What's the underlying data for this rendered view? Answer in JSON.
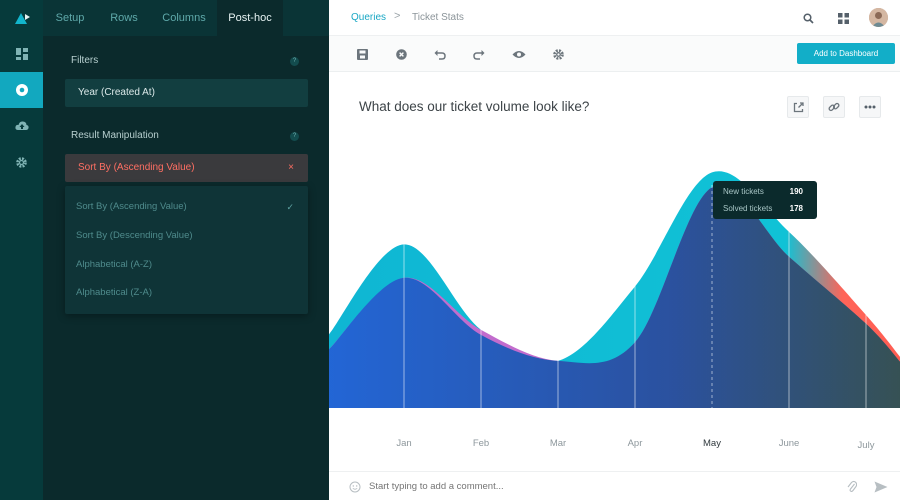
{
  "app": {
    "logo_icon": "brand-logo-icon"
  },
  "rail": {
    "items": [
      {
        "icon": "dashboard-grid-icon",
        "active": false
      },
      {
        "icon": "query-hub-icon",
        "active": true
      },
      {
        "icon": "cloud-upload-icon",
        "active": false
      },
      {
        "icon": "gear-icon",
        "active": false
      }
    ]
  },
  "panel": {
    "tabs": [
      {
        "label": "Setup",
        "active": false
      },
      {
        "label": "Rows",
        "active": false
      },
      {
        "label": "Columns",
        "active": false
      },
      {
        "label": "Post-hoc",
        "active": true
      }
    ],
    "filters_label": "Filters",
    "filter_item": "Year (Created At)",
    "result_label": "Result Manipulation",
    "sort_selected": "Sort By (Ascending Value)",
    "remove_symbol": "×",
    "help_symbol": "?",
    "sort_options": [
      {
        "label": "Sort By (Ascending Value)",
        "checked": true
      },
      {
        "label": "Sort By (Descending Value)",
        "checked": false
      },
      {
        "label": "Alphabetical (A-Z)",
        "checked": false
      },
      {
        "label": "Alphabetical (Z-A)",
        "checked": false
      }
    ],
    "check_symbol": "✓"
  },
  "header": {
    "breadcrumb_root": "Queries",
    "breadcrumb_sep": ">",
    "breadcrumb_current": "Ticket Stats"
  },
  "toolbar": {
    "icons": [
      "save-icon",
      "discard-icon",
      "undo-icon",
      "redo-icon",
      "preview-eye-icon",
      "settings-gear-icon"
    ],
    "add_button": "Add to Dashboard"
  },
  "question": {
    "title": "What does our ticket volume look like?"
  },
  "tooltip": {
    "row1_label": "New tickets",
    "row1_value": "190",
    "row2_label": "Solved tickets",
    "row2_value": "178"
  },
  "colors": {
    "accent": "#12aec8",
    "new_series": "#10c0d6",
    "solved_series": "#1b58c9",
    "danger": "#ff6f63"
  },
  "chart_data": {
    "type": "area",
    "categories": [
      "Jan",
      "Feb",
      "Mar",
      "Apr",
      "May",
      "June",
      "July"
    ],
    "highlighted_category": "May",
    "series": [
      {
        "name": "New tickets",
        "values": [
          132,
          63,
          38,
          98,
          190,
          142,
          75
        ]
      },
      {
        "name": "Solved tickets",
        "values": [
          105,
          59,
          38,
          53,
          178,
          122,
          68
        ]
      }
    ],
    "ylim": [
      0,
      200
    ]
  },
  "footer": {
    "comment_placeholder": "Start typing to add a comment..."
  }
}
